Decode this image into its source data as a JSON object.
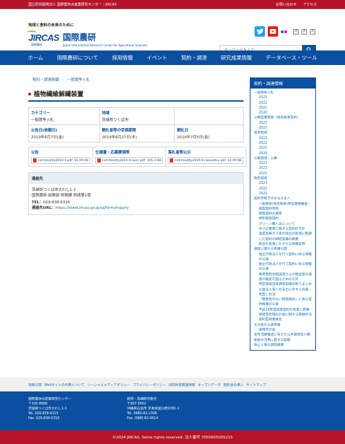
{
  "topbar": {
    "org": "国立研究開発法人 国際農林水産業研究センター｜JIRCAS",
    "contact": "お問い合わせ",
    "access": "アクセス"
  },
  "header": {
    "tagline": "地球と食料の未来のために",
    "logo_text": "JIRCAS",
    "logo_sub": "国際農研",
    "name_jp": "国際農研",
    "name_en": "Japan International Research Center for Agricultural Sciences",
    "twitter_icon": "twitter-icon",
    "youtube_icon": "youtube-icon",
    "flickr_icon": "flickr-icon",
    "font_small": "A",
    "font_medium": "A",
    "font_large": "A",
    "search_placeholder": "キーワードを入力",
    "search_button": "🔍"
  },
  "nav": [
    "ホーム",
    "国際農研について",
    "採用情報",
    "イベント",
    "契約・調達",
    "研究成果情報",
    "データベース・ツール"
  ],
  "breadcrumb": [
    "契約・調達情報",
    "一般競争入札"
  ],
  "page_title": "植物繊維解繊装置",
  "info": {
    "category_label": "カテゴリー",
    "category_value": "一般競争入札",
    "region_label": "地域",
    "region_value": "茨城県つくば市",
    "announce_label": "公告日(依頼日)",
    "announce_value": "2019年6月7日(金)",
    "deadline_label": "開札者等の受領期限",
    "deadline_value": "2019年6月27日(木)",
    "open_label": "開札日",
    "open_value": "2019年7月5日(金)"
  },
  "files": {
    "notice_label": "公告",
    "notice_file": "commodity2019-4.pdf",
    "notice_size": "81.99 KB",
    "spec_label": "仕様書・応募要領等",
    "spec_file": "commodity2019-4-spec.pdf",
    "spec_size": "145.3 KB",
    "result_label": "落札者等公示",
    "result_file": "commodity2019-4-rakusatsu.pdf",
    "result_size": "42.99 KB"
  },
  "contact": {
    "heading": "連絡先",
    "address": "茨城県つくば市大わし1-1",
    "division": "国際農研 総務部 財務課 調達第1係",
    "tel_label": "TEL：",
    "tel": "029-838-6326",
    "url_label": "連絡先URL：",
    "url": "https://www.jircas.go.jp/ja/form/inquiry"
  },
  "sidebar": {
    "heading": "契約・調達情報",
    "items": [
      {
        "level": 0,
        "text": "一般競争入札"
      },
      {
        "level": 1,
        "text": "2023"
      },
      {
        "level": 1,
        "text": "2022"
      },
      {
        "level": 1,
        "text": "2021"
      },
      {
        "level": 1,
        "text": "2020"
      },
      {
        "level": 0,
        "text": "公募型業競争（指名競争契約）"
      },
      {
        "level": 1,
        "text": "2023"
      },
      {
        "level": 1,
        "text": "2022"
      },
      {
        "level": 0,
        "text": "意見招請"
      },
      {
        "level": 1,
        "text": "2023"
      },
      {
        "level": 1,
        "text": "2022"
      },
      {
        "level": 1,
        "text": "2021"
      },
      {
        "level": 1,
        "text": "2020"
      },
      {
        "level": 0,
        "text": "公募調達・公募"
      },
      {
        "level": 1,
        "text": "2023"
      },
      {
        "level": 1,
        "text": "2022"
      },
      {
        "level": 1,
        "text": "2021"
      },
      {
        "level": 0,
        "text": "政府調達"
      },
      {
        "level": 1,
        "text": "2023"
      },
      {
        "level": 1,
        "text": "2022"
      },
      {
        "level": 1,
        "text": "2020"
      },
      {
        "level": 0,
        "text": "契約手続きのみなさまへ"
      },
      {
        "level": 2,
        "text": "一般競争(指名競争)参加資格審査・随意契約参照"
      },
      {
        "level": 2,
        "text": "随意契約の基準"
      },
      {
        "level": 2,
        "text": "特別随意契約"
      },
      {
        "level": 2,
        "text": "グリーン購入法について"
      },
      {
        "level": 2,
        "text": "中小企業者に関する契約の方針"
      },
      {
        "level": 2,
        "text": "温室効果ガス等の排出の削減に配慮した契約の締結実績の概要"
      },
      {
        "level": 2,
        "text": "政治の意識したかかる情報提供"
      },
      {
        "level": 0,
        "text": "調達に関わる情報公開"
      },
      {
        "level": 2,
        "text": "独立行政法人が行う契約に係る情報の公表"
      },
      {
        "level": 2,
        "text": "独立行政法人が行う契約に係る情報の公表"
      },
      {
        "level": 2,
        "text": "障害者就労施設等からの物品等の調達の推進を図るための方針"
      },
      {
        "level": 2,
        "text": "特定調達品目調達実績の取りまとめ"
      },
      {
        "level": 2,
        "text": "公益法人等への支出に対する点検・見直し状況"
      },
      {
        "level": 2,
        "text": "「随意性のない随意契約」に係る契約情報の公表"
      },
      {
        "level": 2,
        "text": "平成18年度随意契約の見直し結果"
      },
      {
        "level": 2,
        "text": "調達等合理化計画に関する取組状況"
      },
      {
        "level": 2,
        "text": "契約監視委員会"
      },
      {
        "level": 0,
        "text": "その他の公表情報"
      },
      {
        "level": 2,
        "text": "運用年計画"
      },
      {
        "level": 0,
        "text": "女性活躍推進に向けた公共調達及び補助金の活用に関する取組"
      },
      {
        "level": 0,
        "text": "防止人事の調達概要"
      }
    ]
  },
  "footer_links": [
    "情報公開",
    "Webサイトの利用について",
    "ソーシャルメディアポリシー",
    "プライバシーポリシー",
    "知的財産関連情報",
    "オープンデータ",
    "個別会の導入",
    "サイトマップ"
  ],
  "footer": {
    "org": "国際農林水産業研究センター",
    "zip": "〒305-8686",
    "addr": "茨城県つくば市大わし1-1",
    "tel": "Tel. 029-838-6313",
    "fax": "Fax. 029-838-6316",
    "branch": "熱帯・島嶼研究拠点",
    "branch_zip": "〒907-0002",
    "branch_addr": "沖縄県石垣市 字真栄里川原1091-1",
    "branch_tel": "Tel. 0980-82-2306",
    "branch_fax": "Fax. 0980-82-0614"
  },
  "copyright": "©2024 JIRCAS. Some rights reserved. 法人番号 7050005005215",
  "colors": {
    "brand_red": "#b5132a",
    "brand_blue": "#0b4fa0"
  }
}
